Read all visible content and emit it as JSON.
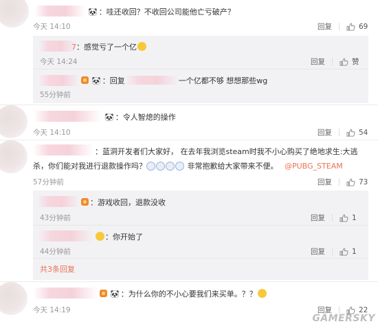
{
  "actions": {
    "reply": "回复"
  },
  "comments": [
    {
      "id": "c1",
      "text": "：哇还收回？不收回公司能他亡亏破产？",
      "time": "今天 14:10",
      "likes": "69",
      "replies": [
        {
          "text": "感觉亏了一个亿",
          "time": "今天 14:24",
          "likes": "赞"
        },
        {
          "prefix": "回复",
          "text": "一个亿都不够  想想那些wg",
          "time": "55分钟前"
        }
      ]
    },
    {
      "id": "c2",
      "text": "：令人智熄的操作",
      "time": "今天 14:10",
      "likes": "54"
    },
    {
      "id": "c3",
      "text_line1": "：蓝洞开发者们大家好，  在去年我浏览steam时我不小心购买了绝地求生:大逃",
      "text_line2_a": "杀，你们能对我进行退款操作吗？",
      "text_line2_b": "非常抱歉给大家带来不便。",
      "mention": "@PUBG_STEAM",
      "time": "57分钟前",
      "likes": "73",
      "replies": [
        {
          "text": "：游戏收回，退款没收",
          "time": "43分钟前",
          "likes": "1"
        },
        {
          "text": "：你开始了",
          "time": "44分钟前",
          "likes": "1"
        }
      ],
      "more": "共3条回复"
    },
    {
      "id": "c4",
      "text": "：为什么你的不小心要我们来买单。？？",
      "time": "今天 14:19",
      "likes": "22"
    }
  ],
  "watermark": "GAMERSKY",
  "colors": {
    "accent": "#eb7350",
    "meta": "#999999",
    "subBg": "#f2f2f5"
  },
  "icons": [
    "panda-emoji-icon",
    "face-emoji-icon",
    "thumb-up-icon",
    "badge-icon",
    "cry-emoji-icon"
  ]
}
